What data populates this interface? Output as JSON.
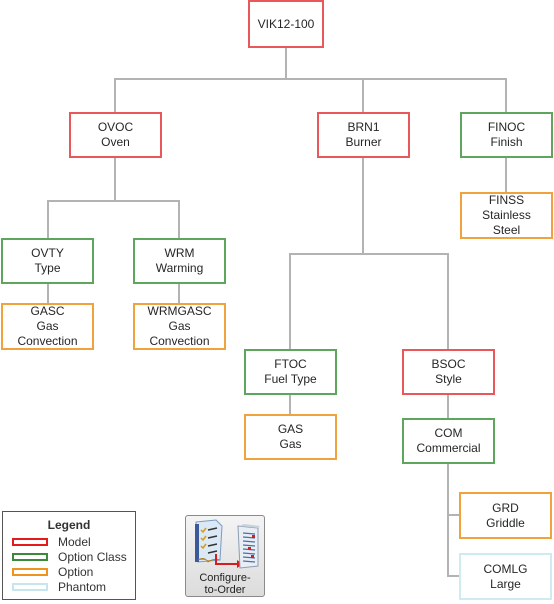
{
  "diagram": {
    "root": {
      "code": "VIK12-100",
      "desc": "",
      "type": "model"
    },
    "nodes": {
      "ovoc": {
        "code": "OVOC",
        "desc": "Oven",
        "type": "model"
      },
      "brn1": {
        "code": "BRN1",
        "desc": "Burner",
        "type": "model"
      },
      "finoc": {
        "code": "FINOC",
        "desc": "Finish",
        "type": "option-class"
      },
      "finss": {
        "code": "FINSS",
        "desc1": "Stainless",
        "desc2": "Steel",
        "type": "option"
      },
      "ovty": {
        "code": "OVTY",
        "desc": "Type",
        "type": "option-class"
      },
      "wrm": {
        "code": "WRM",
        "desc": "Warming",
        "type": "option-class"
      },
      "gasc": {
        "code": "GASC",
        "desc1": "Gas",
        "desc2": "Convection",
        "type": "option"
      },
      "wrmgasc": {
        "code": "WRMGASC",
        "desc1": "Gas",
        "desc2": "Convection",
        "type": "option"
      },
      "ftoc": {
        "code": "FTOC",
        "desc": "Fuel Type",
        "type": "option-class"
      },
      "bsoc": {
        "code": "BSOC",
        "desc": "Style",
        "type": "model"
      },
      "gas": {
        "code": "GAS",
        "desc": "Gas",
        "type": "option"
      },
      "com": {
        "code": "COM",
        "desc": "Commercial",
        "type": "option-class"
      },
      "grd": {
        "code": "GRD",
        "desc": "Griddle",
        "type": "option"
      },
      "comlg": {
        "code": "COMLG",
        "desc": "Large",
        "type": "phantom"
      }
    },
    "edges": [
      [
        "VIK12-100",
        "OVOC"
      ],
      [
        "VIK12-100",
        "BRN1"
      ],
      [
        "VIK12-100",
        "FINOC"
      ],
      [
        "FINOC",
        "FINSS"
      ],
      [
        "OVOC",
        "OVTY"
      ],
      [
        "OVOC",
        "WRM"
      ],
      [
        "OVTY",
        "GASC"
      ],
      [
        "WRM",
        "WRMGASC"
      ],
      [
        "BRN1",
        "FTOC"
      ],
      [
        "BRN1",
        "BSOC"
      ],
      [
        "FTOC",
        "GAS"
      ],
      [
        "BSOC",
        "COM"
      ],
      [
        "COM",
        "GRD"
      ],
      [
        "COM",
        "COMLG"
      ]
    ]
  },
  "legend": {
    "title": "Legend",
    "items": [
      {
        "label": "Model",
        "color": "#e8585b"
      },
      {
        "label": "Option Class",
        "color": "#5ea65e"
      },
      {
        "label": "Option",
        "color": "#f0a33c"
      },
      {
        "label": "Phantom",
        "color": "#cfeaf0"
      }
    ]
  },
  "badge": {
    "icon": "configure-to-order-icon",
    "line1": "Configure-",
    "line2": "to-Order"
  },
  "colors": {
    "model": "#e8585b",
    "option_class": "#5ea65e",
    "option": "#f0a33c",
    "phantom": "#cfeaf0",
    "connector": "#b3b3b3"
  }
}
